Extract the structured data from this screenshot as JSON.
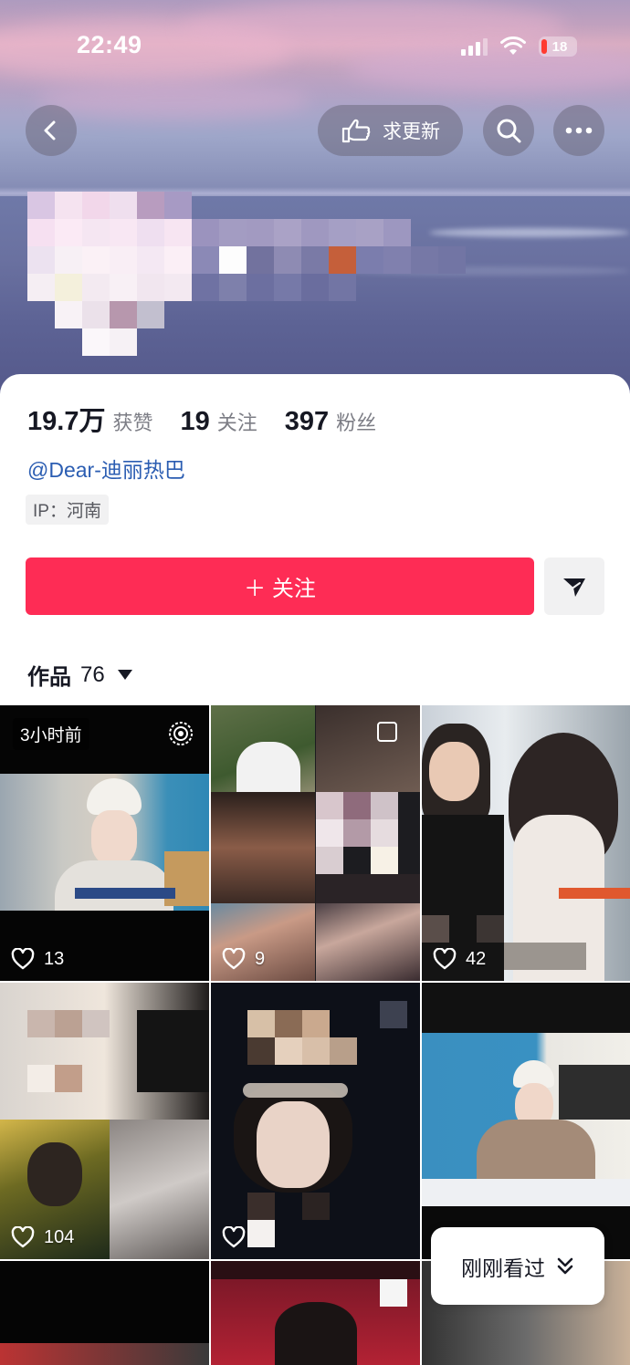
{
  "status_bar": {
    "time": "22:49",
    "battery": "18"
  },
  "header": {
    "request_update_label": "求更新"
  },
  "profile": {
    "stats": [
      {
        "value": "19.7万",
        "label": "获赞"
      },
      {
        "value": "19",
        "label": "关注"
      },
      {
        "value": "397",
        "label": "粉丝"
      }
    ],
    "handle": "@Dear-迪丽热巴",
    "ip": "IP：河南",
    "follow_label": "＋ 关注"
  },
  "works": {
    "label": "作品",
    "count": "76"
  },
  "grid": {
    "tiles": [
      {
        "likes": "13",
        "time_badge": "3小时前"
      },
      {
        "likes": "9"
      },
      {
        "likes": "42"
      },
      {
        "likes": "104"
      },
      {
        "likes": ""
      },
      {
        "likes": ""
      }
    ]
  },
  "recent_label": "刚刚看过",
  "colors": {
    "accent": "#fe2c55",
    "link": "#2b5db2"
  }
}
